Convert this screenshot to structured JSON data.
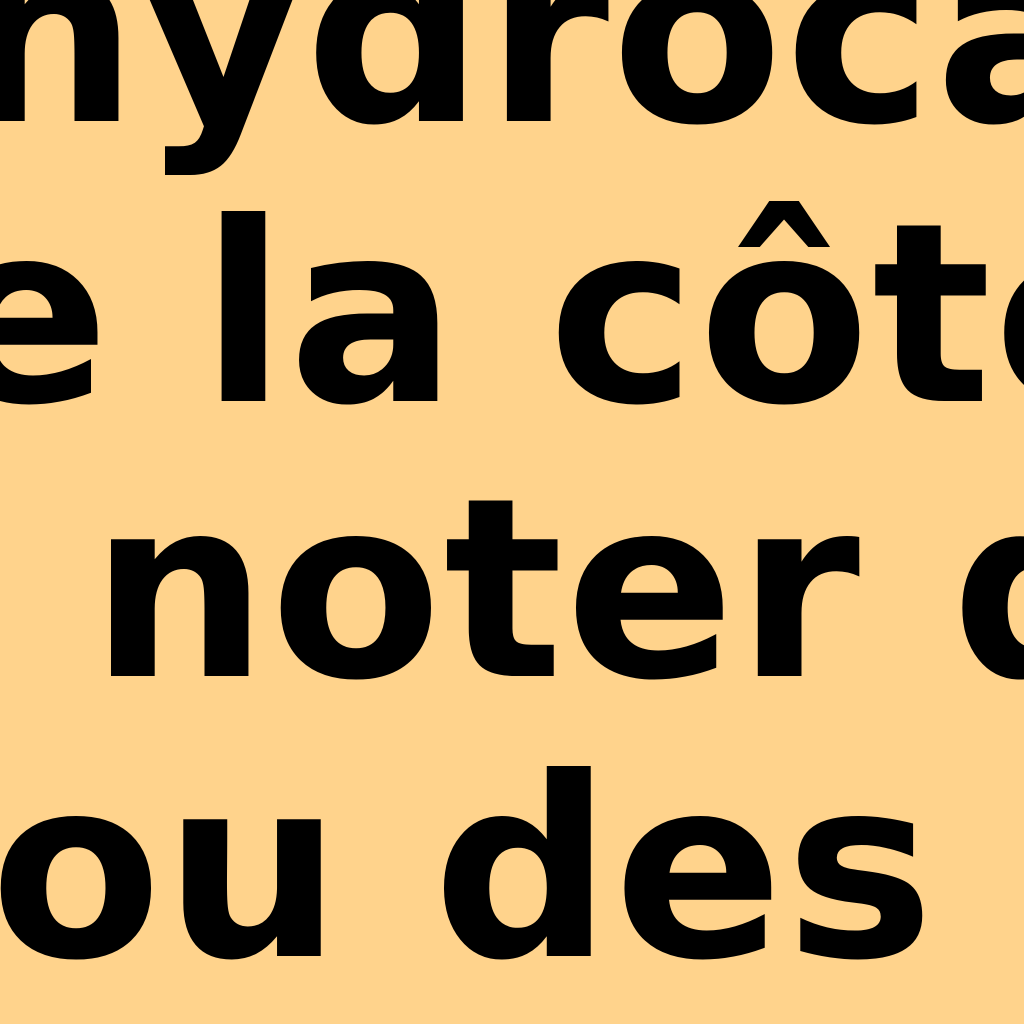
{
  "document": {
    "lines": [
      "hydrocarbu",
      "e la côte",
      "noter qu",
      "ou des na"
    ]
  }
}
